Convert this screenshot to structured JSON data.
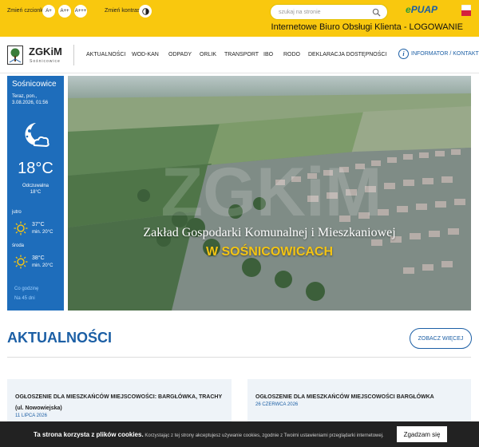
{
  "topbar": {
    "font_label": "Zmień czcionkę:",
    "font_buttons": [
      "A+",
      "A++",
      "A+++"
    ],
    "contrast_label": "Zmień kontrast:",
    "search_placeholder": "szukaj na stronie",
    "epuap_e": "e",
    "epuap_rest": "PUAP",
    "ibok": "Internetowe Biuro Obsługi Klienta - LOGOWANIE"
  },
  "nav": {
    "logo_name": "ZGKiM",
    "logo_sub": "Sośnicowice",
    "items": [
      "AKTUALNOŚCI",
      "WOD-KAN",
      "ODPADY",
      "ORLIK",
      "TRANSPORT",
      "IBO",
      "RODO",
      "DEKLARACJA DOSTĘPNOŚCI"
    ],
    "informator": "INFORMATOR / KONTAKT"
  },
  "weather": {
    "city": "Sośnicowice",
    "now_line1": "Teraz, pon.,",
    "now_line2": "3.08.2026, 01:56",
    "temp": "18°C",
    "feel_label": "Odczuwalna",
    "feel_value": "18°C",
    "days": [
      {
        "name": "jutro",
        "temp": "37°C",
        "min": "min. 20°C"
      },
      {
        "name": "środa",
        "temp": "38°C",
        "min": "min. 20°C"
      }
    ],
    "hourly": "Co godzinę",
    "forecast45": "Na 45 dni"
  },
  "hero": {
    "title": "Zakład Gospodarki Komunalnej i Mieszkaniowej",
    "subtitle": "W SOŚNICOWICACH"
  },
  "news": {
    "heading": "AKTUALNOŚCI",
    "more": "ZOBACZ WIĘCEJ",
    "cards": [
      {
        "title": "OGŁOSZENIE DLA MIESZKAŃCÓW MIEJSCOWOŚCI: BARGŁÓWKA, TRACHY (ul. Nowowiejska)",
        "date": "11 LIPCA 2026"
      },
      {
        "title": "OGŁOSZENIE DLA MIESZKAŃCÓW MIEJSCOWOŚCI BARGŁÓWKA",
        "date": "26 CZERWCA 2026"
      }
    ]
  },
  "cookie": {
    "bold": "Ta strona korzysta z plików cookies.",
    "text": "Korzystając z tej strony akceptujesz używanie cookies, zgodnie z Twoimi ustawieniami przeglądarki internetowej.",
    "button": "Zgadzam się"
  },
  "colors": {
    "accent": "#f9c80e",
    "brand": "#1c5fa5",
    "weather_bg": "#1e6dbb"
  }
}
